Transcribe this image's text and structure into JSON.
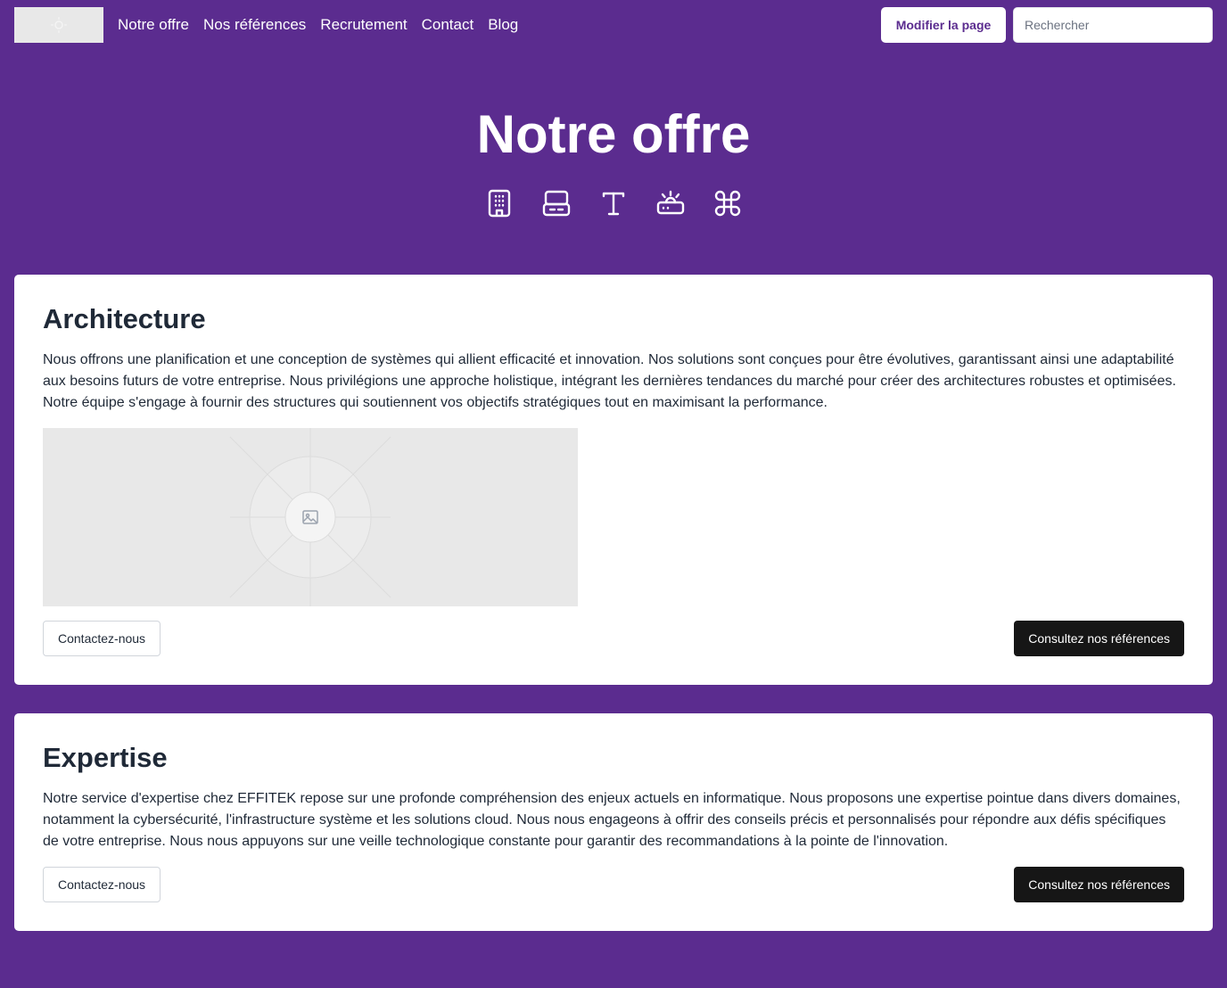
{
  "nav": {
    "links": [
      "Notre offre",
      "Nos références",
      "Recrutement",
      "Contact",
      "Blog"
    ],
    "edit_button": "Modifier la page",
    "search_placeholder": "Rechercher"
  },
  "hero": {
    "title": "Notre offre",
    "icons": [
      "building-icon",
      "server-icon",
      "text-icon",
      "router-icon",
      "command-icon"
    ]
  },
  "sections": [
    {
      "title": "Architecture",
      "text": "Nous offrons une planification et une conception de systèmes qui allient efficacité et innovation. Nos solutions sont conçues pour être évolutives, garantissant ainsi une adaptabilité aux besoins futurs de votre entreprise. Nous privilégions une approche holistique, intégrant les dernières tendances du marché pour créer des architectures robustes et optimisées. Notre équipe s'engage à fournir des structures qui soutiennent vos objectifs stratégiques tout en maximisant la performance.",
      "contact_button": "Contactez-nous",
      "references_button": "Consultez nos références"
    },
    {
      "title": "Expertise",
      "text": "Notre service d'expertise chez EFFITEK repose sur une profonde compréhension des enjeux actuels en informatique. Nous proposons une expertise pointue dans divers domaines, notamment la cybersécurité, l'infrastructure système et les solutions cloud. Nous nous engageons à offrir des conseils précis et personnalisés pour répondre aux défis spécifiques de votre entreprise. Nous nous appuyons sur une veille technologique constante pour garantir des recommandations à la pointe de l'innovation.",
      "contact_button": "Contactez-nous",
      "references_button": "Consultez nos références"
    }
  ],
  "colors": {
    "background": "#5b2c8f",
    "card": "#ffffff",
    "dark_button": "#161616",
    "placeholder": "#e8e8e8"
  }
}
